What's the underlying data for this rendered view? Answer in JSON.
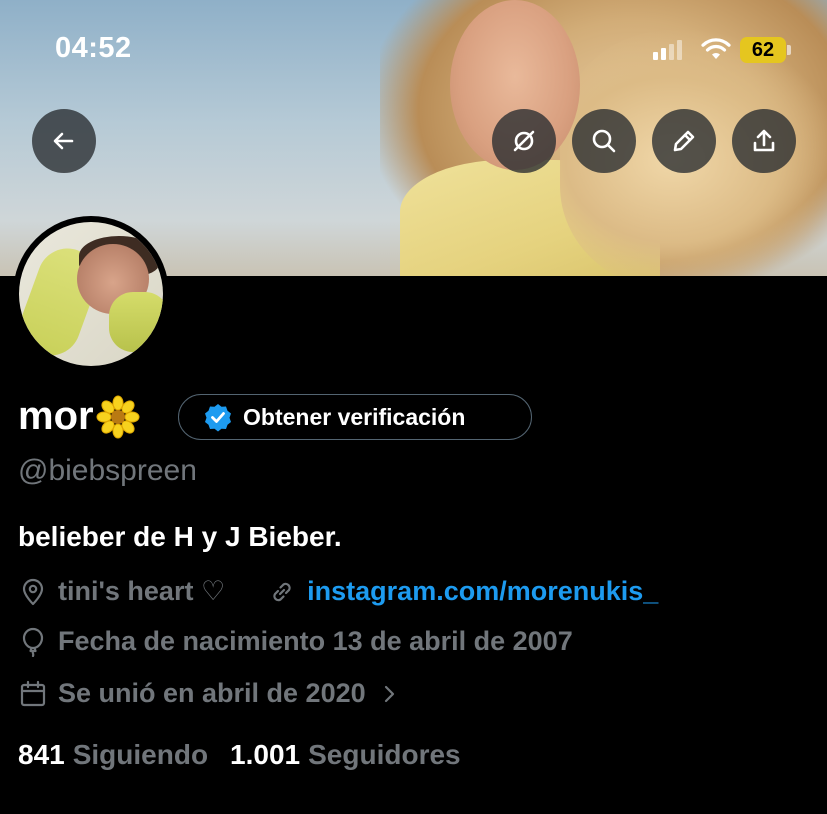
{
  "status_bar": {
    "time": "04:52",
    "battery_percent": "62",
    "battery_color": "#e5c61f"
  },
  "toolbar": {
    "back_icon": "arrow-left-icon",
    "grok_icon": "grok-icon",
    "search_icon": "search-icon",
    "edit_icon": "pencil-icon",
    "share_icon": "share-icon"
  },
  "profile": {
    "display_name": "mor",
    "name_emoji": "blossom-flower",
    "verify_button_label": "Obtener verificación",
    "handle": "@biebspreen",
    "bio": "belieber de H y J Bieber.",
    "location": "tini's heart ♡",
    "website": "instagram.com/morenukis_",
    "birthday": "Fecha de nacimiento 13 de abril de 2007",
    "joined": "Se unió en abril de 2020",
    "following_count": "841",
    "following_label": "Siguiendo",
    "followers_count": "1.001",
    "followers_label": "Seguidores"
  },
  "colors": {
    "background": "#000000",
    "link": "#1d9bf0",
    "secondary_text": "#71767b",
    "verified_badge": "#1d9bf0"
  }
}
